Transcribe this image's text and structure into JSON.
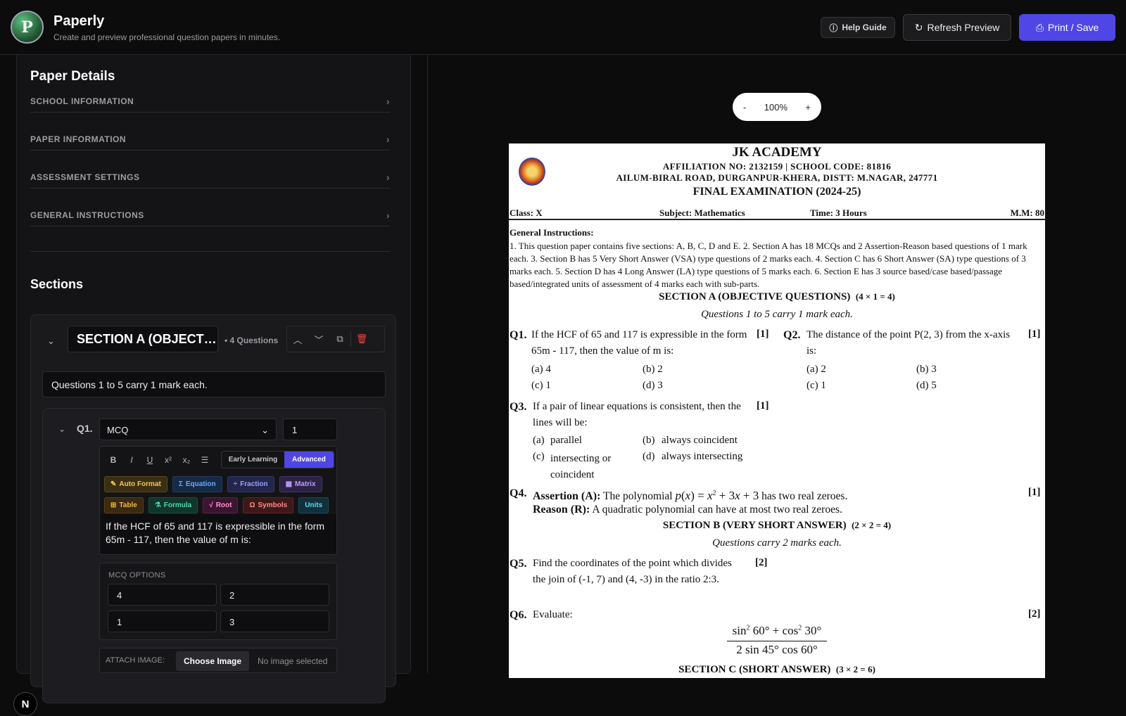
{
  "app": {
    "logo_letter": "P",
    "title": "Paperly",
    "subtitle": "Create and preview professional question papers in minutes.",
    "help_label": "Help Guide",
    "refresh_label": "Refresh Preview",
    "print_label": "Print / Save",
    "accent_color": "#4f46e5"
  },
  "left": {
    "panel_title": "Paper Details",
    "accordions": [
      "SCHOOL INFORMATION",
      "PAPER INFORMATION",
      "ASSESSMENT SETTINGS",
      "GENERAL INSTRUCTIONS"
    ],
    "sections_title": "Sections",
    "section": {
      "name": "SECTION A (OBJECT…",
      "count": "• 4 Questions",
      "instruction": "Questions 1 to 5 carry 1 mark each."
    },
    "question": {
      "number": "Q1.",
      "type": "MCQ",
      "marks": "1",
      "format_icons": [
        "B",
        "I",
        "U",
        "x²",
        "x₂",
        "☰"
      ],
      "mode_early": "Early Learning",
      "mode_advanced": "Advanced",
      "tools": [
        "Auto Format",
        "Equation",
        "Fraction",
        "Matrix",
        "Table",
        "Formula",
        "Root",
        "Symbols",
        "Units"
      ],
      "text": "If the HCF of 65 and 117 is expressible in the form 65m - 117, then the value of m is:",
      "options_label": "MCQ OPTIONS",
      "options": [
        "4",
        "2",
        "1",
        "3"
      ],
      "attach_label": "ATTACH IMAGE:",
      "attach_button": "Choose Image",
      "attach_status": "No image selected"
    },
    "badge": "N"
  },
  "preview": {
    "zoom_minus": "-",
    "zoom_level": "100%",
    "zoom_plus": "+",
    "school": "JK ACADEMY",
    "affiliation": "AFFILIATION NO: 2132159 | SCHOOL CODE: 81816",
    "address": "AILUM-BIRAL ROAD, DURGANPUR-KHERA, DISTT: M.NAGAR, 247771",
    "exam": "FINAL EXAMINATION (2024-25)",
    "class": "Class: X",
    "subject": "Subject: Mathematics",
    "time": "Time: 3 Hours",
    "max_marks": "M.M: 80",
    "gi_heading": "General Instructions:",
    "gi_text": "1. This question paper contains five sections: A, B, C, D and E. 2. Section A has 18 MCQs and 2 Assertion-Reason based questions of 1 mark each. 3. Section B has 5 Very Short Answer (VSA) type questions of 2 marks each. 4. Section C has 6 Short Answer (SA) type questions of 3 marks each. 5. Section D has 4 Long Answer (LA) type questions of 5 marks each. 6. Section E has 3 source based/case based/passage based/integrated units of assessment of 4 marks each with sub-parts.",
    "sec_a": "SECTION A (OBJECTIVE QUESTIONS)",
    "sec_a_marks": "(4 × 1 = 4)",
    "sec_a_instr": "Questions 1 to 5 carry 1 mark each.",
    "q1": {
      "num": "Q1.",
      "text": "If the HCF of 65 and 117 is expressible in the form 65m - 117, then the value of m is:",
      "marks": "[1]",
      "opts": [
        "(a)  4",
        "(b)  2",
        "(c)  1",
        "(d)  3"
      ]
    },
    "q2": {
      "num": "Q2.",
      "text": "The distance of the point P(2, 3) from the x-axis is:",
      "marks": "[1]",
      "opts": [
        "(a)  2",
        "(b)  3",
        "(c)  1",
        "(d)  5"
      ]
    },
    "q3": {
      "num": "Q3.",
      "text": "If a pair of linear equations is consistent, then the lines will be:",
      "marks": "[1]",
      "opts": [
        "(a)",
        "parallel",
        "(b)",
        "always coincident",
        "(c)",
        "intersecting or coincident",
        "(d)",
        "always intersecting"
      ]
    },
    "q4": {
      "num": "Q4.",
      "assertion_label": "Assertion (A):",
      "assertion_pre": "The polynomial",
      "assertion_post": "has two real zeroes.",
      "reason_label": "Reason (R):",
      "reason": "A quadratic polynomial can have at most two real zeroes.",
      "marks": "[1]"
    },
    "sec_b": "SECTION B (VERY SHORT ANSWER)",
    "sec_b_marks": "(2 × 2 = 4)",
    "sec_b_instr": "Questions carry 2 marks each.",
    "q5": {
      "num": "Q5.",
      "text": "Find the coordinates of the point which divides the join of (-1, 7) and (4, -3) in the ratio 2:3.",
      "marks": "[2]"
    },
    "q6": {
      "num": "Q6.",
      "text": "Evaluate:",
      "marks": "[2]"
    },
    "sec_c": "SECTION C (SHORT ANSWER)",
    "sec_c_marks": "(3 × 2 = 6)"
  }
}
